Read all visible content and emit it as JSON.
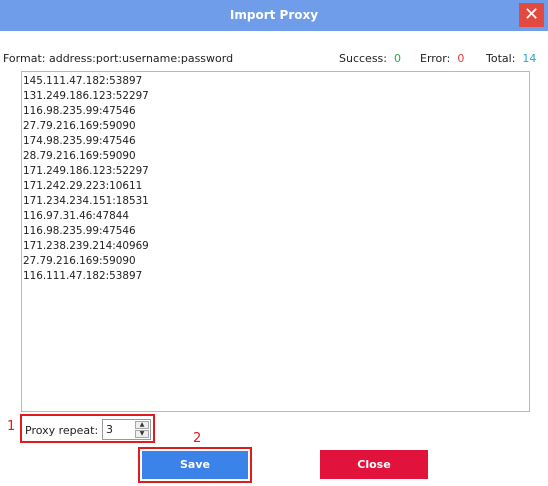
{
  "window": {
    "title": "Import Proxy",
    "close_glyph": "✕"
  },
  "info": {
    "format": "Format: address:port:username:password",
    "success_label": "Success:",
    "success_value": "0",
    "error_label": "Error:",
    "error_value": "0",
    "total_label": "Total:",
    "total_value": "14"
  },
  "proxies": [
    "145.111.47.182:53897",
    "131.249.186.123:52297",
    "116.98.235.99:47546",
    "27.79.216.169:59090",
    "174.98.235.99:47546",
    "28.79.216.169:59090",
    "171.249.186.123:52297",
    "171.242.29.223:10611",
    "171.234.234.151:18531",
    "116.97.31.46:47844",
    "116.98.235.99:47546",
    "171.238.239.214:40969",
    "27.79.216.169:59090",
    "116.111.47.182:53897"
  ],
  "repeat": {
    "label": "Proxy repeat:",
    "value": "3"
  },
  "annotations": {
    "one": "1",
    "two": "2"
  },
  "buttons": {
    "save": "Save",
    "close": "Close"
  },
  "colors": {
    "titlebar": "#6f9de9",
    "success": "#23b23b",
    "error": "#e23b3b",
    "total": "#24a7c8",
    "save": "#3b82e9",
    "close": "#e1133c",
    "annotation": "#e01b1b"
  }
}
